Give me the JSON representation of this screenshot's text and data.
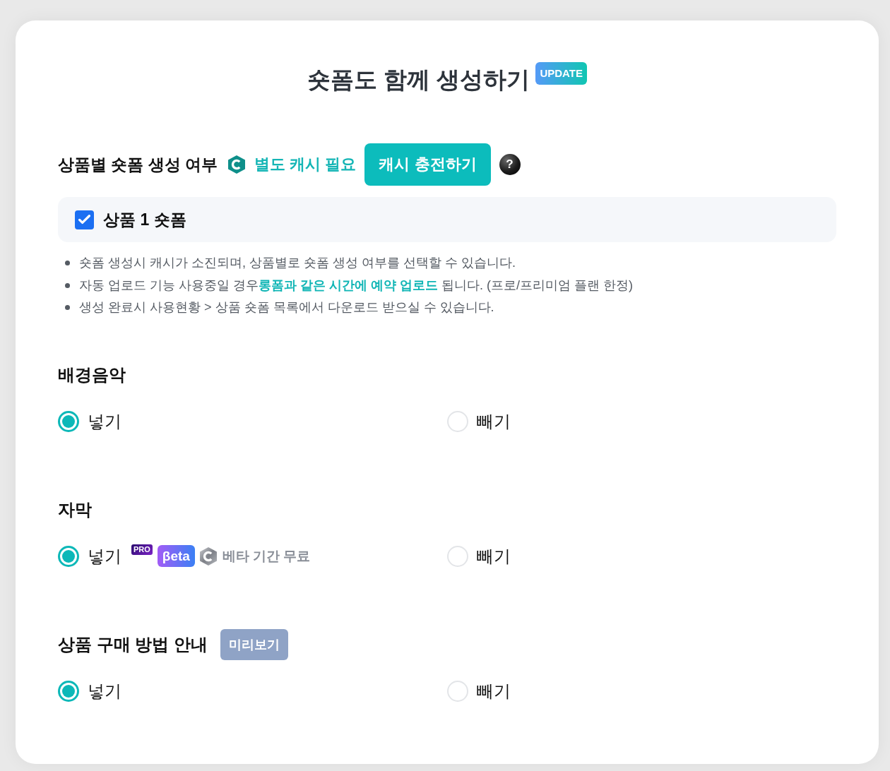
{
  "title": {
    "text": "숏폼도 함께 생성하기",
    "badge": "UPDATE"
  },
  "shortform": {
    "label": "상품별 숏폼 생성 여부",
    "cash_note": "별도 캐시 필요",
    "charge_button": "캐시 충전하기",
    "help": "?",
    "options": [
      {
        "label": "상품 1 숏폼",
        "checked": true
      }
    ],
    "notes": [
      "숏폼 생성시 캐시가 소진되며, 상품별로 숏폼 생성 여부를 선택할 수 있습니다.",
      "자동 업로드 기능 사용중일 경우**롱폼과 같은 시간에 예약 업로드** 됩니다. (프로/프리미엄 플랜 한정)",
      "생성 완료시 사용현황 > 상품 숏폼 목록에서 다운로드 받으실 수 있습니다."
    ]
  },
  "sections": [
    {
      "title": "배경음악",
      "options": [
        {
          "label": "넣기",
          "selected": true
        },
        {
          "label": "빼기",
          "selected": false
        }
      ]
    },
    {
      "title": "자막",
      "options": [
        {
          "label": "넣기",
          "selected": true,
          "badges": [
            {
              "kind": "pro",
              "text": "PRO"
            },
            {
              "kind": "beta",
              "text": "βeta"
            }
          ],
          "free_note": "베타 기간 무료"
        },
        {
          "label": "빼기",
          "selected": false
        }
      ]
    },
    {
      "title": "상품 구매 방법 안내",
      "preview_button": "미리보기",
      "options": [
        {
          "label": "넣기",
          "selected": true
        },
        {
          "label": "빼기",
          "selected": false
        }
      ]
    }
  ]
}
